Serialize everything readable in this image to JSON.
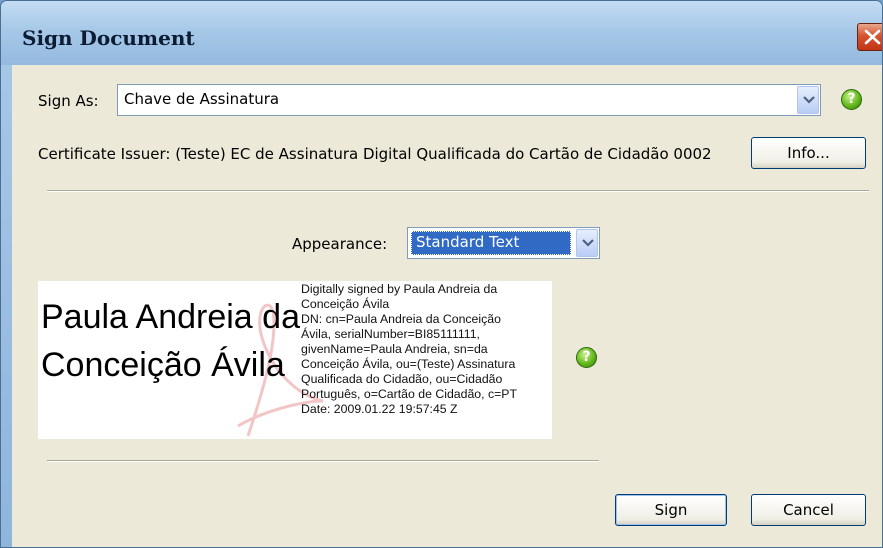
{
  "window": {
    "title": "Sign Document"
  },
  "sign_as": {
    "label": "Sign As:",
    "selected": "Chave de Assinatura"
  },
  "certificate": {
    "issuer_text": "Certificate Issuer: (Teste) EC de Assinatura Digital Qualificada do Cartão de Cidadão 0002",
    "info_button": "Info..."
  },
  "appearance": {
    "label": "Appearance:",
    "selected": "Standard Text"
  },
  "preview": {
    "name": "Paula Andreia da Conceição Ávila",
    "details": [
      "Digitally signed by Paula Andreia da",
      "Conceição Ávila",
      "DN: cn=Paula Andreia da Conceição",
      "Ávila, serialNumber=BI85111111,",
      "givenName=Paula Andreia, sn=da",
      "Conceição Ávila, ou=(Teste) Assinatura",
      "Qualificada do Cidadão, ou=Cidadão",
      "Português, o=Cartão de Cidadão, c=PT",
      "Date: 2009.01.22 19:57:45 Z"
    ]
  },
  "buttons": {
    "sign": "Sign",
    "cancel": "Cancel"
  },
  "help_glyph": "?",
  "colors": {
    "accent_help": "#64b81c",
    "close_button": "#d5542f",
    "selection": "#316ac5"
  }
}
